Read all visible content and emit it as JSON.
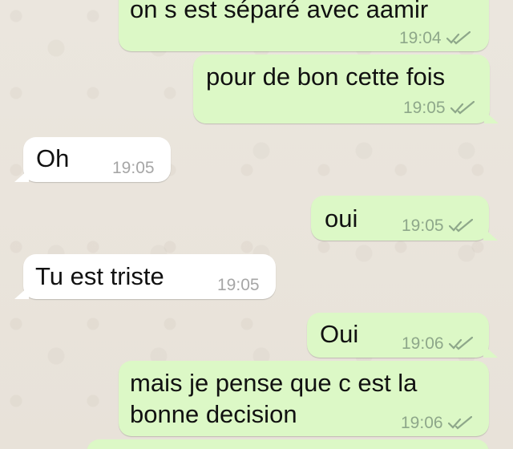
{
  "messages": [
    {
      "text": "on s est séparé avec aamir",
      "time": "19:04",
      "receipt_icon": "double-check-icon"
    },
    {
      "text": "pour de bon cette fois",
      "time": "19:05",
      "receipt_icon": "double-check-icon"
    },
    {
      "text": "Oh",
      "time": "19:05"
    },
    {
      "text": "oui",
      "time": "19:05",
      "receipt_icon": "double-check-icon"
    },
    {
      "text": "Tu est triste",
      "time": "19:05"
    },
    {
      "text": "Oui",
      "time": "19:06",
      "receipt_icon": "double-check-icon"
    },
    {
      "line1": "mais je pense que c est la",
      "line2": "bonne decision",
      "time": "19:06",
      "receipt_icon": "double-check-icon"
    }
  ],
  "colors": {
    "outgoing_bubble": "#dcf8c6",
    "incoming_bubble": "#ffffff",
    "background": "#e9e4dc",
    "read_receipt": "#8ea78a"
  }
}
